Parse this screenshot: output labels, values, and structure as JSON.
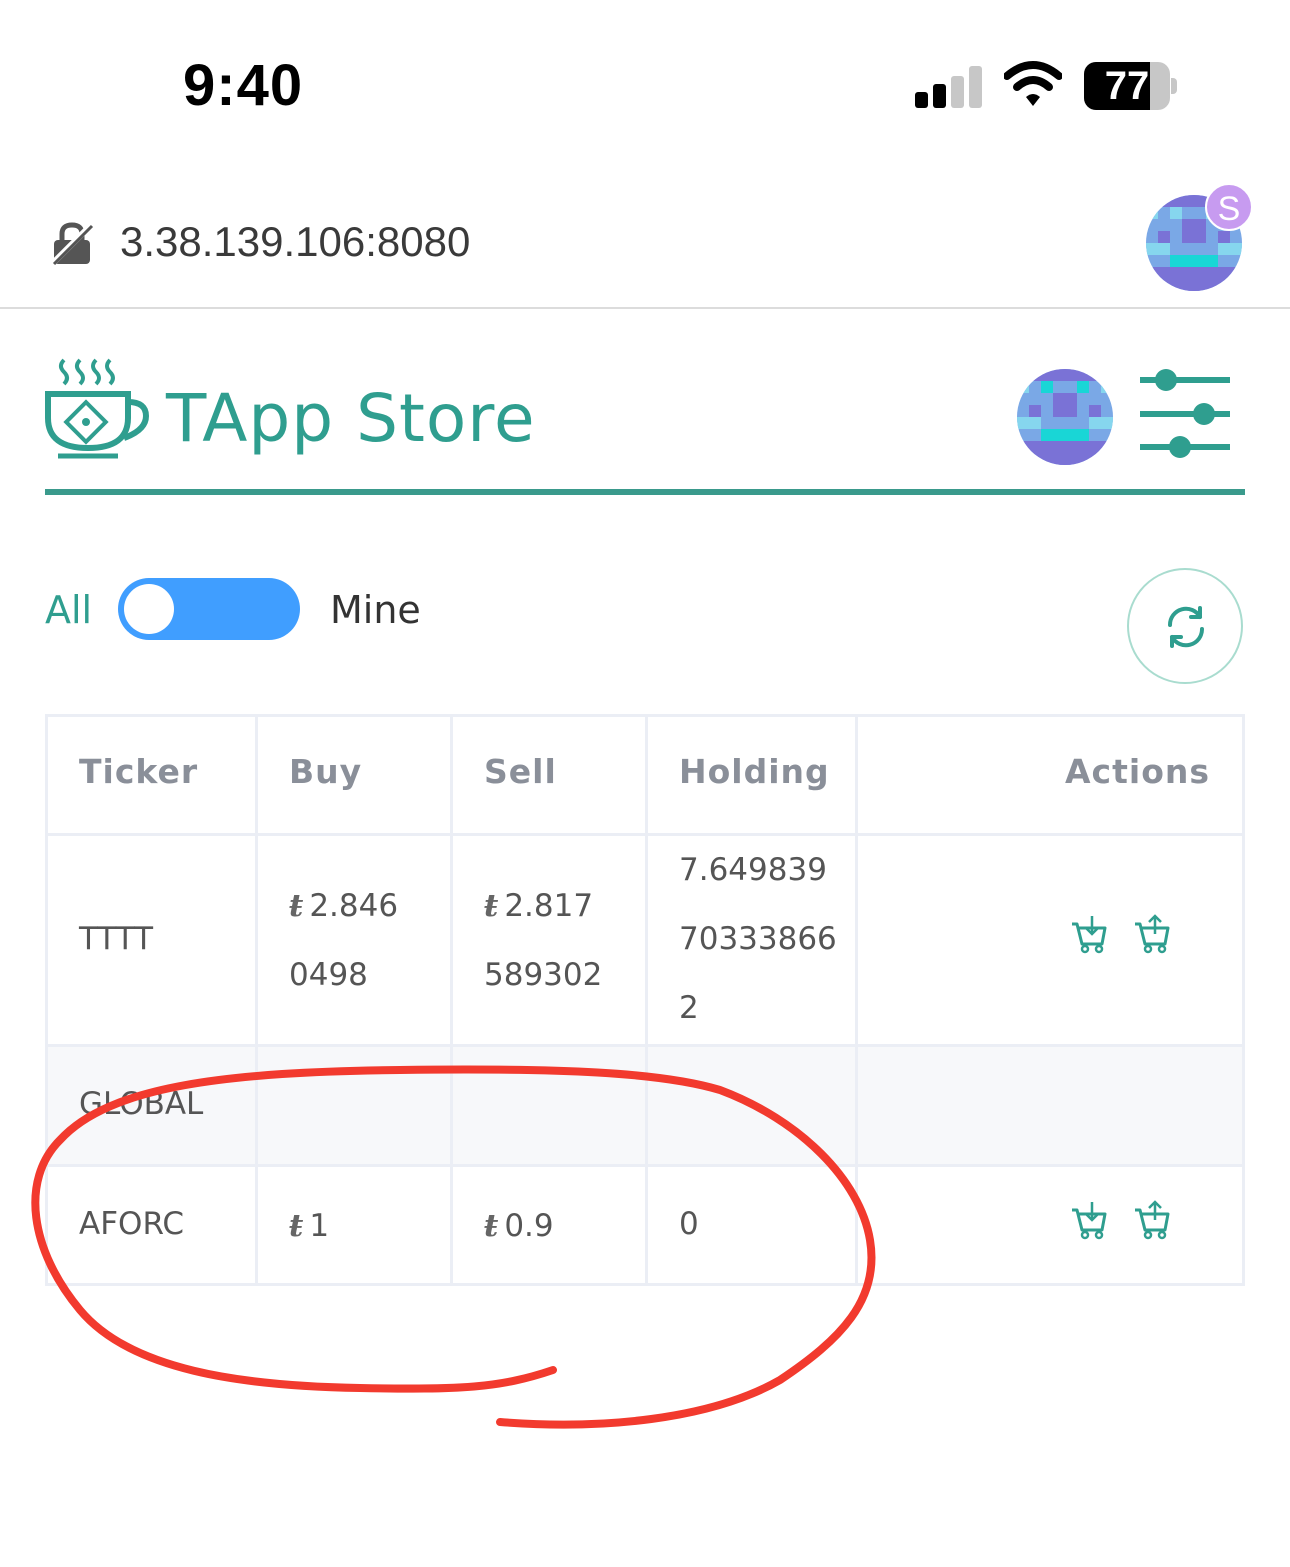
{
  "status_bar": {
    "time": "9:40",
    "battery_level": "77",
    "battery_fraction": 0.77,
    "icons": [
      "cellular-signal-icon",
      "wifi-icon",
      "battery-icon"
    ]
  },
  "address_bar": {
    "url": "3.38.139.106:8080",
    "security_icon": "not-secure-lock-icon",
    "profile_badge": "S"
  },
  "header": {
    "title": "TApp Store",
    "logo_icon": "tea-cup-chip-icon",
    "filter_icon": "sliders-icon"
  },
  "filter": {
    "left_label": "All",
    "right_label": "Mine",
    "refresh_icon": "refresh-icon"
  },
  "table": {
    "headers": {
      "ticker": "Ticker",
      "buy": "Buy",
      "sell": "Sell",
      "holding": "Holding",
      "actions": "Actions"
    },
    "currency_symbol": "ŧ",
    "rows": [
      {
        "ticker": "TTTT",
        "buy_l1": "2.846",
        "buy_l2": "0498",
        "sell_l1": "2.817",
        "sell_l2": "589302",
        "holding_l1": "7.649839",
        "holding_l2": "70333866",
        "holding_l3": "2"
      },
      {
        "group": "GLOBAL"
      },
      {
        "ticker": "AFORC",
        "buy": "1",
        "sell": "0.9",
        "holding": "0"
      }
    ],
    "action_icons": [
      "buy-cart-icon",
      "sell-cart-icon"
    ]
  },
  "colors": {
    "brand_teal": "#2f9e8f",
    "toggle_blue": "#409eff",
    "annotation_red": "#f23a2e"
  }
}
